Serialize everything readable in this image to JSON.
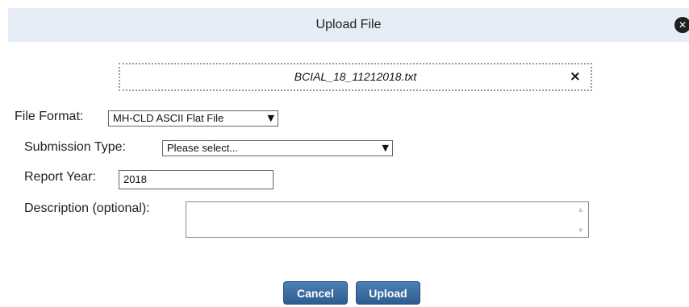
{
  "dialog": {
    "title": "Upload File",
    "close_icon": "close-circle-icon"
  },
  "file": {
    "name": "BCIAL_18_11212018.txt",
    "remove_glyph": "×",
    "remove_icon": "close-icon"
  },
  "form": {
    "file_format": {
      "label": "File Format:",
      "value": "MH-CLD ASCII Flat File"
    },
    "submission_type": {
      "label": "Submission Type:",
      "value": "Please select..."
    },
    "report_year": {
      "label": "Report Year:",
      "value": "2018"
    },
    "description": {
      "label": "Description (optional):",
      "value": ""
    }
  },
  "buttons": {
    "cancel": "Cancel",
    "upload": "Upload"
  },
  "colors": {
    "title_bar_bg": "#e6edf6",
    "button_bg": "#3b6aa0",
    "button_text": "#ffffff"
  }
}
